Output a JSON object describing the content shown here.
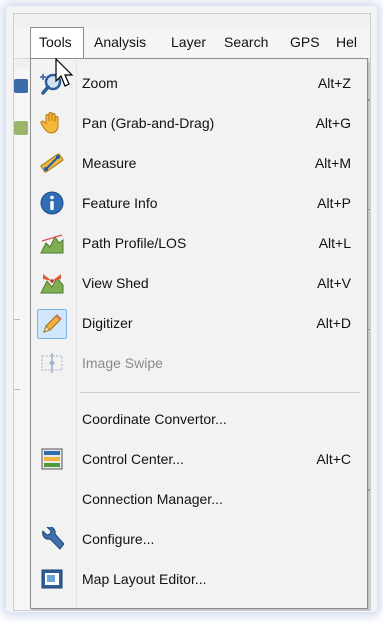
{
  "menubar": {
    "items": [
      {
        "label": "Tools"
      },
      {
        "label": "Analysis"
      },
      {
        "label": "Layer"
      },
      {
        "label": "Search"
      },
      {
        "label": "GPS"
      },
      {
        "label": "Hel"
      }
    ]
  },
  "menu": {
    "items": [
      {
        "label": "Zoom",
        "shortcut": "Alt+Z",
        "icon": "zoom-icon"
      },
      {
        "label": "Pan (Grab-and-Drag)",
        "shortcut": "Alt+G",
        "icon": "pan-hand-icon"
      },
      {
        "label": "Measure",
        "shortcut": "Alt+M",
        "icon": "ruler-icon"
      },
      {
        "label": "Feature Info",
        "shortcut": "Alt+P",
        "icon": "info-icon"
      },
      {
        "label": "Path Profile/LOS",
        "shortcut": "Alt+L",
        "icon": "path-profile-icon"
      },
      {
        "label": "View Shed",
        "shortcut": "Alt+V",
        "icon": "view-shed-icon"
      },
      {
        "label": "Digitizer",
        "shortcut": "Alt+D",
        "icon": "pencil-icon",
        "checked": true
      },
      {
        "label": "Image Swipe",
        "shortcut": "",
        "icon": "image-swipe-icon",
        "disabled": true
      },
      {
        "label": "Coordinate Convertor...",
        "shortcut": "",
        "icon": ""
      },
      {
        "label": "Control Center...",
        "shortcut": "Alt+C",
        "icon": "control-center-icon"
      },
      {
        "label": "Connection Manager...",
        "shortcut": "",
        "icon": ""
      },
      {
        "label": "Configure...",
        "shortcut": "",
        "icon": "wrench-icon"
      },
      {
        "label": "Map Layout Editor...",
        "shortcut": "",
        "icon": "map-layout-icon"
      }
    ]
  },
  "colors": {
    "menu_bg": "#f2f2f2",
    "selected_bg": "#cfe6fb",
    "selected_border": "#7bb3e6",
    "disabled_text": "#8a8a8a"
  }
}
